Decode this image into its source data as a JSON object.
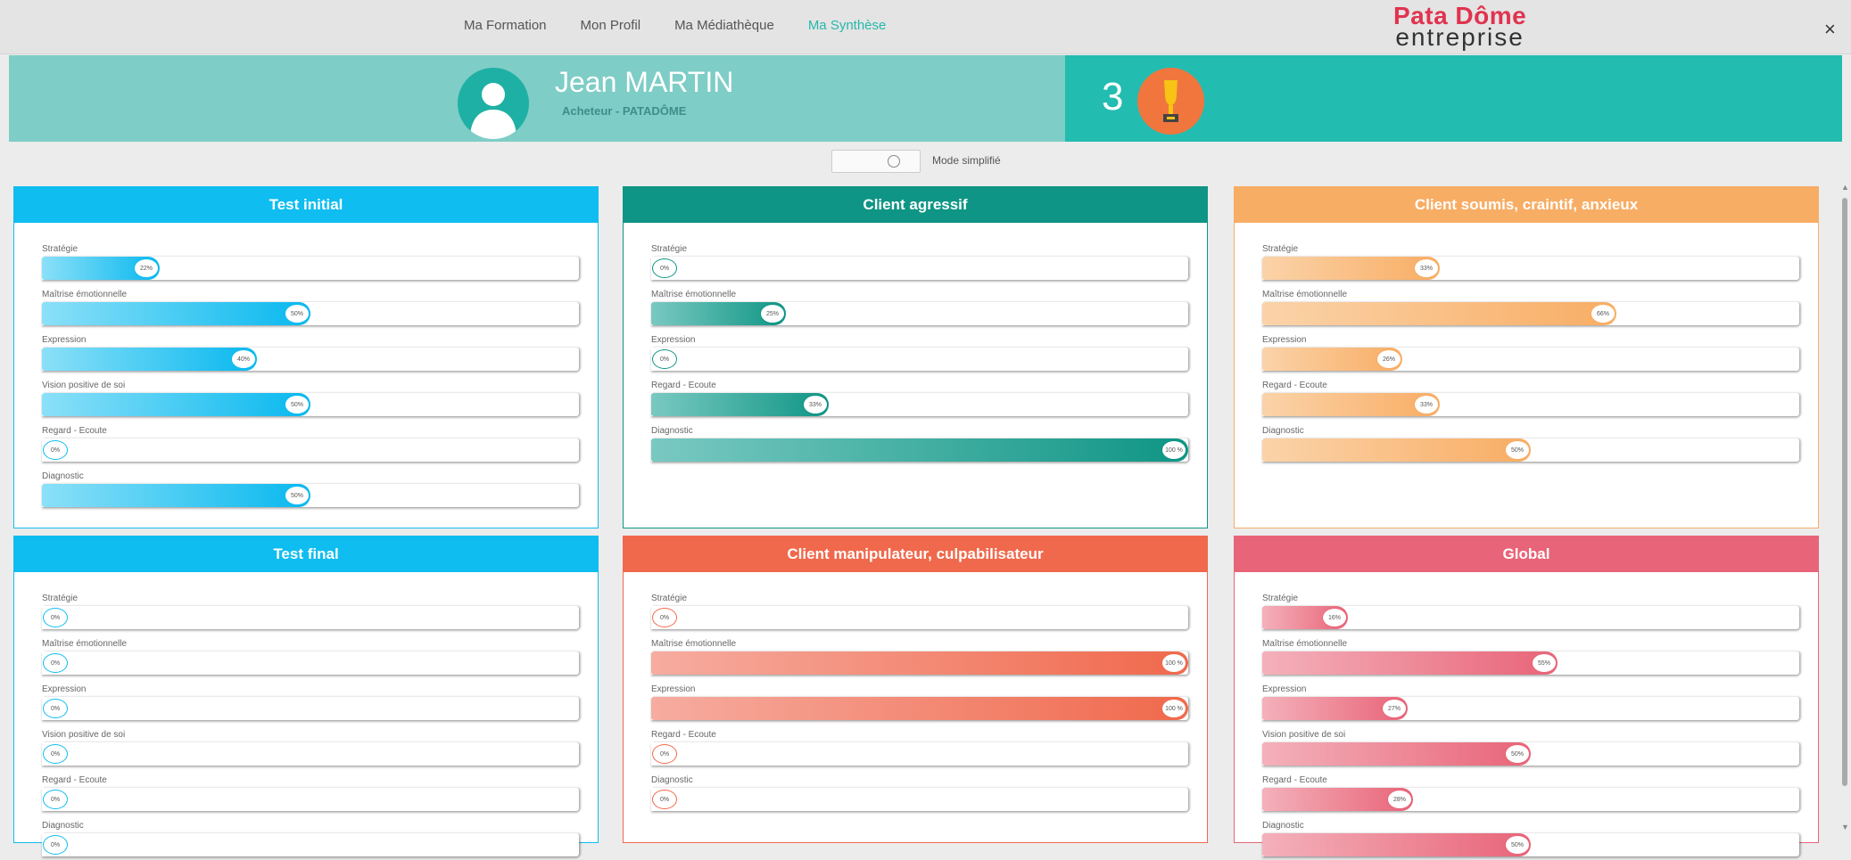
{
  "nav": {
    "items": [
      {
        "label": "Ma Formation",
        "active": false
      },
      {
        "label": "Mon Profil",
        "active": false
      },
      {
        "label": "Ma Médiathèque",
        "active": false
      },
      {
        "label": "Ma Synthèse",
        "active": true
      }
    ]
  },
  "logo": {
    "line1": "Pata Dôme",
    "line2": "entreprise"
  },
  "close_label": "×",
  "user": {
    "name": "Jean MARTIN",
    "role": "Acheteur - PATADÔME"
  },
  "trophy": {
    "count": "3"
  },
  "mode": {
    "label": "Mode simplifié"
  },
  "colors": {
    "cyan": "#0fbdf0",
    "teal": "#0f9585",
    "orange": "#f8ad64",
    "coral": "#f0694c",
    "pink": "#e86478"
  },
  "panels": [
    {
      "title": "Test initial",
      "color": "#0fbdf0",
      "fill_from": "#8be0f8",
      "fill_to": "#08b8ef",
      "metrics": [
        {
          "label": "Stratégie",
          "value": 0.22,
          "text": "22%"
        },
        {
          "label": "Maîtrise émotionnelle",
          "value": 0.5,
          "text": "50%"
        },
        {
          "label": "Expression",
          "value": 0.4,
          "text": "40%"
        },
        {
          "label": "Vision positive de soi",
          "value": 0.5,
          "text": "50%"
        },
        {
          "label": "Regard - Ecoute",
          "value": 0.0,
          "text": "0%"
        },
        {
          "label": "Diagnostic",
          "value": 0.5,
          "text": "50%"
        }
      ]
    },
    {
      "title": "Client agressif",
      "color": "#0f9585",
      "fill_from": "#79c9c1",
      "fill_to": "#0f9585",
      "metrics": [
        {
          "label": "Stratégie",
          "value": 0.0,
          "text": "0%"
        },
        {
          "label": "Maîtrise émotionnelle",
          "value": 0.25,
          "text": "25%"
        },
        {
          "label": "Expression",
          "value": 0.0,
          "text": "0%"
        },
        {
          "label": "Regard - Ecoute",
          "value": 0.33,
          "text": "33%"
        },
        {
          "label": "Diagnostic",
          "value": 1.0,
          "text": "100 %"
        }
      ]
    },
    {
      "title": "Client soumis, craintif, anxieux",
      "color": "#f8ad64",
      "fill_from": "#fbd3a9",
      "fill_to": "#f8ad64",
      "metrics": [
        {
          "label": "Stratégie",
          "value": 0.33,
          "text": "33%"
        },
        {
          "label": "Maîtrise émotionnelle",
          "value": 0.66,
          "text": "66%"
        },
        {
          "label": "Expression",
          "value": 0.26,
          "text": "26%"
        },
        {
          "label": "Regard - Ecoute",
          "value": 0.33,
          "text": "33%"
        },
        {
          "label": "Diagnostic",
          "value": 0.5,
          "text": "50%"
        }
      ]
    },
    {
      "title": "Test final",
      "color": "#0fbdf0",
      "fill_from": "#8be0f8",
      "fill_to": "#08b8ef",
      "metrics": [
        {
          "label": "Stratégie",
          "value": 0.0,
          "text": "0%"
        },
        {
          "label": "Maîtrise émotionnelle",
          "value": 0.0,
          "text": "0%"
        },
        {
          "label": "Expression",
          "value": 0.0,
          "text": "0%"
        },
        {
          "label": "Vision positive de soi",
          "value": 0.0,
          "text": "0%"
        },
        {
          "label": "Regard - Ecoute",
          "value": 0.0,
          "text": "0%"
        },
        {
          "label": "Diagnostic",
          "value": 0.0,
          "text": "0%"
        }
      ]
    },
    {
      "title": "Client manipulateur, culpabilisateur",
      "color": "#f0694c",
      "fill_from": "#f6aca0",
      "fill_to": "#f0694c",
      "metrics": [
        {
          "label": "Stratégie",
          "value": 0.0,
          "text": "0%"
        },
        {
          "label": "Maîtrise émotionnelle",
          "value": 1.0,
          "text": "100 %"
        },
        {
          "label": "Expression",
          "value": 1.0,
          "text": "100 %"
        },
        {
          "label": "Regard - Ecoute",
          "value": 0.0,
          "text": "0%"
        },
        {
          "label": "Diagnostic",
          "value": 0.0,
          "text": "0%"
        }
      ]
    },
    {
      "title": "Global",
      "color": "#e86478",
      "fill_from": "#f4b1bb",
      "fill_to": "#e86478",
      "metrics": [
        {
          "label": "Stratégie",
          "value": 0.16,
          "text": "16%"
        },
        {
          "label": "Maîtrise émotionnelle",
          "value": 0.55,
          "text": "55%"
        },
        {
          "label": "Expression",
          "value": 0.27,
          "text": "27%"
        },
        {
          "label": "Vision positive de soi",
          "value": 0.5,
          "text": "50%"
        },
        {
          "label": "Regard - Ecoute",
          "value": 0.28,
          "text": "28%"
        },
        {
          "label": "Diagnostic",
          "value": 0.5,
          "text": "50%"
        }
      ]
    }
  ]
}
